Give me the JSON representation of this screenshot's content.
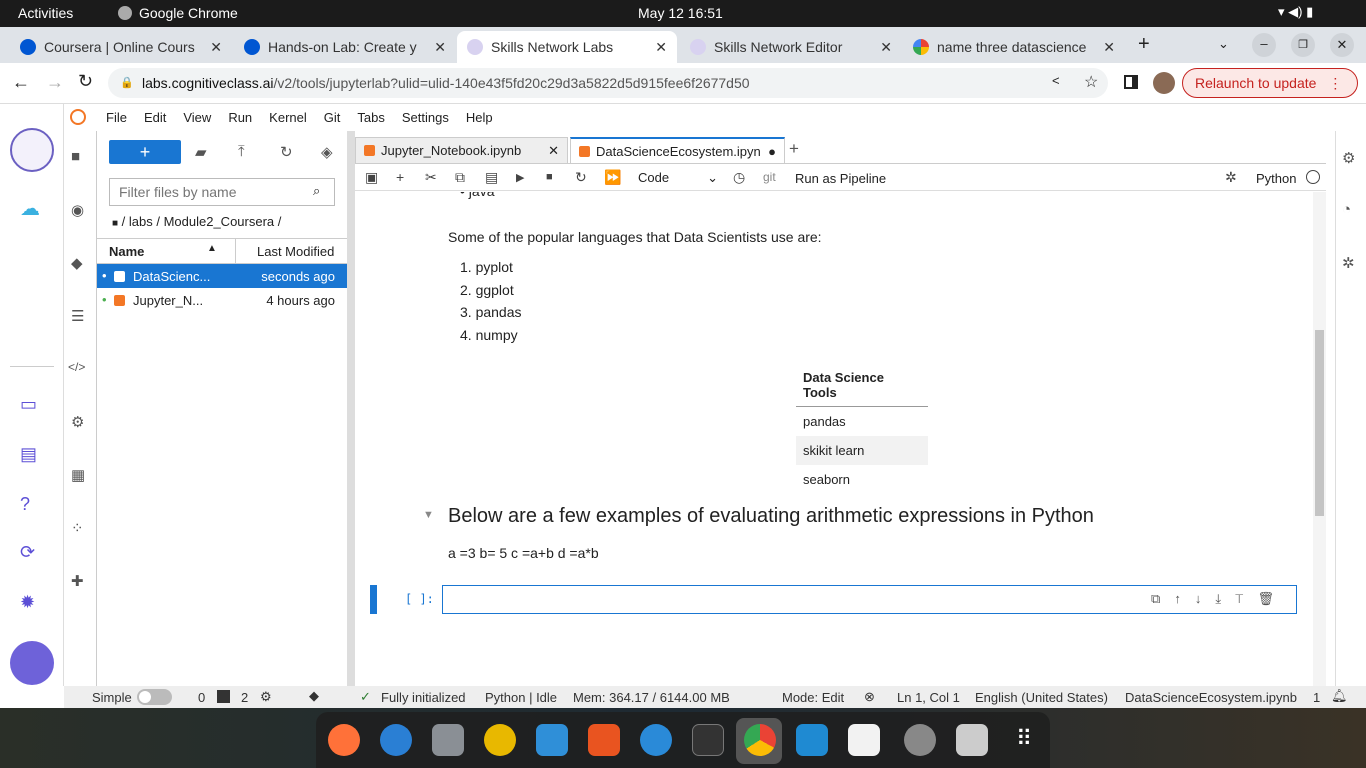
{
  "system": {
    "activities": "Activities",
    "app": "Google Chrome",
    "datetime": "May 12  16:51"
  },
  "browser": {
    "tabs": [
      {
        "title": "Coursera | Online Cours",
        "active": false
      },
      {
        "title": "Hands-on Lab: Create y",
        "active": false
      },
      {
        "title": "Skills Network Labs",
        "active": true
      },
      {
        "title": "Skills Network Editor",
        "active": false
      },
      {
        "title": "name three datascience",
        "active": false
      }
    ],
    "url_host": "labs.cognitiveclass.ai",
    "url_path": "/v2/tools/jupyterlab?ulid=ulid-140e43f5fd20c29d3a5822d5d915fee6f2677d50",
    "relaunch": "Relaunch to update"
  },
  "menu": [
    "File",
    "Edit",
    "View",
    "Run",
    "Kernel",
    "Git",
    "Tabs",
    "Settings",
    "Help"
  ],
  "filebrowser": {
    "filter_placeholder": "Filter files by name",
    "breadcrumb": "/ labs / Module2_Coursera /",
    "col_name": "Name",
    "col_modified": "Last Modified",
    "files": [
      {
        "name": "DataScienc...",
        "modified": "seconds ago",
        "selected": true
      },
      {
        "name": "Jupyter_N...",
        "modified": "4 hours ago",
        "selected": false
      }
    ]
  },
  "notebook": {
    "tabs": [
      {
        "title": "Jupyter_Notebook.ipynb"
      },
      {
        "title": "DataScienceEcosystem.ipyn"
      }
    ],
    "cell_type": "Code",
    "git": "git",
    "pipeline": "Run as Pipeline",
    "kernel": "Python",
    "prev_item": "java",
    "langs_intro": "Some of the popular languages that Data Scientists use are:",
    "langs": [
      "pyplot",
      "ggplot",
      "pandas",
      "numpy"
    ],
    "table_header": "Data Science Tools",
    "table_rows": [
      "pandas",
      "skikit learn",
      "seaborn"
    ],
    "heading": "Below are a few examples of evaluating arithmetic expressions in Python",
    "expr": "a =3 b= 5 c =a+b d =a*b",
    "prompt": "[ ]:"
  },
  "status": {
    "mode_label": "Simple",
    "n1": "0",
    "n2": "2",
    "init": "Fully initialized",
    "kernel": "Python | Idle",
    "mem": "Mem: 364.17 / 6144.00 MB",
    "mode": "Mode: Edit",
    "pos": "Ln 1, Col 1",
    "lang": "English (United States)",
    "file": "DataScienceEcosystem.ipynb",
    "count": "1"
  }
}
